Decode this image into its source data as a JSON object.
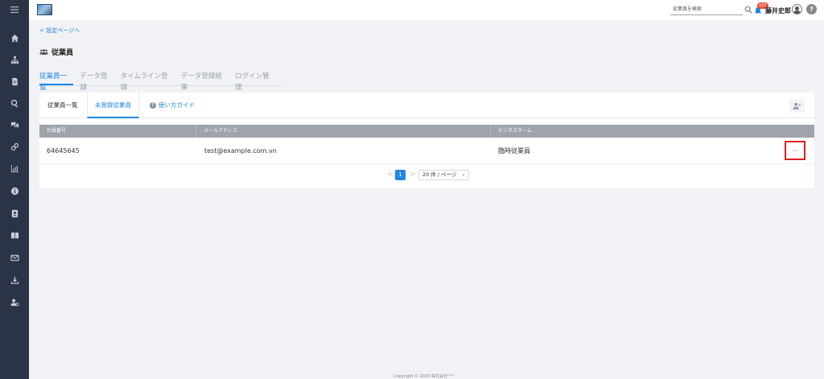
{
  "header": {
    "search_placeholder": "従業員を検索",
    "notification_count": "107",
    "user_name": "藤井史郎",
    "help_label": "?"
  },
  "sidebar": {
    "items": [
      "menu-icon",
      "home-icon",
      "org-chart-icon",
      "document-icon",
      "search-icon",
      "chat-icon",
      "link-icon",
      "chart-icon",
      "info-icon",
      "contacts-icon",
      "book-icon",
      "mail-icon",
      "download-icon",
      "user-settings-icon"
    ]
  },
  "page": {
    "back_link": "< 設定ページへ",
    "title": "従業員"
  },
  "tabs": [
    {
      "label": "従業員一覧",
      "active": true
    },
    {
      "label": "データ登録",
      "active": false
    },
    {
      "label": "タイムライン登録",
      "active": false
    },
    {
      "label": "データ登録結果",
      "active": false
    },
    {
      "label": "ログイン管理",
      "active": false
    }
  ],
  "subtabs": {
    "list": "従業員一覧",
    "unregistered": "未登録従業員",
    "guide": "使い方ガイド",
    "guide_icon": "?"
  },
  "table": {
    "columns": [
      "社員番号",
      "メールアドレス",
      "ビジネスネーム"
    ],
    "rows": [
      {
        "employee_no": "64645645",
        "email": "test@example.com.vn",
        "business_name": "臨時従業員",
        "action": "···"
      }
    ]
  },
  "pagination": {
    "prev": "<",
    "current": "1",
    "next": ">",
    "page_size": "20 件 / ページ",
    "chevron": "∨"
  },
  "footer": {
    "text": "Copyright © 2020 株式会社ᴾᴬᵀᴬ"
  },
  "colors": {
    "accent": "#1f87e5",
    "sidebar": "#2b3446",
    "highlight": "#e02020"
  }
}
